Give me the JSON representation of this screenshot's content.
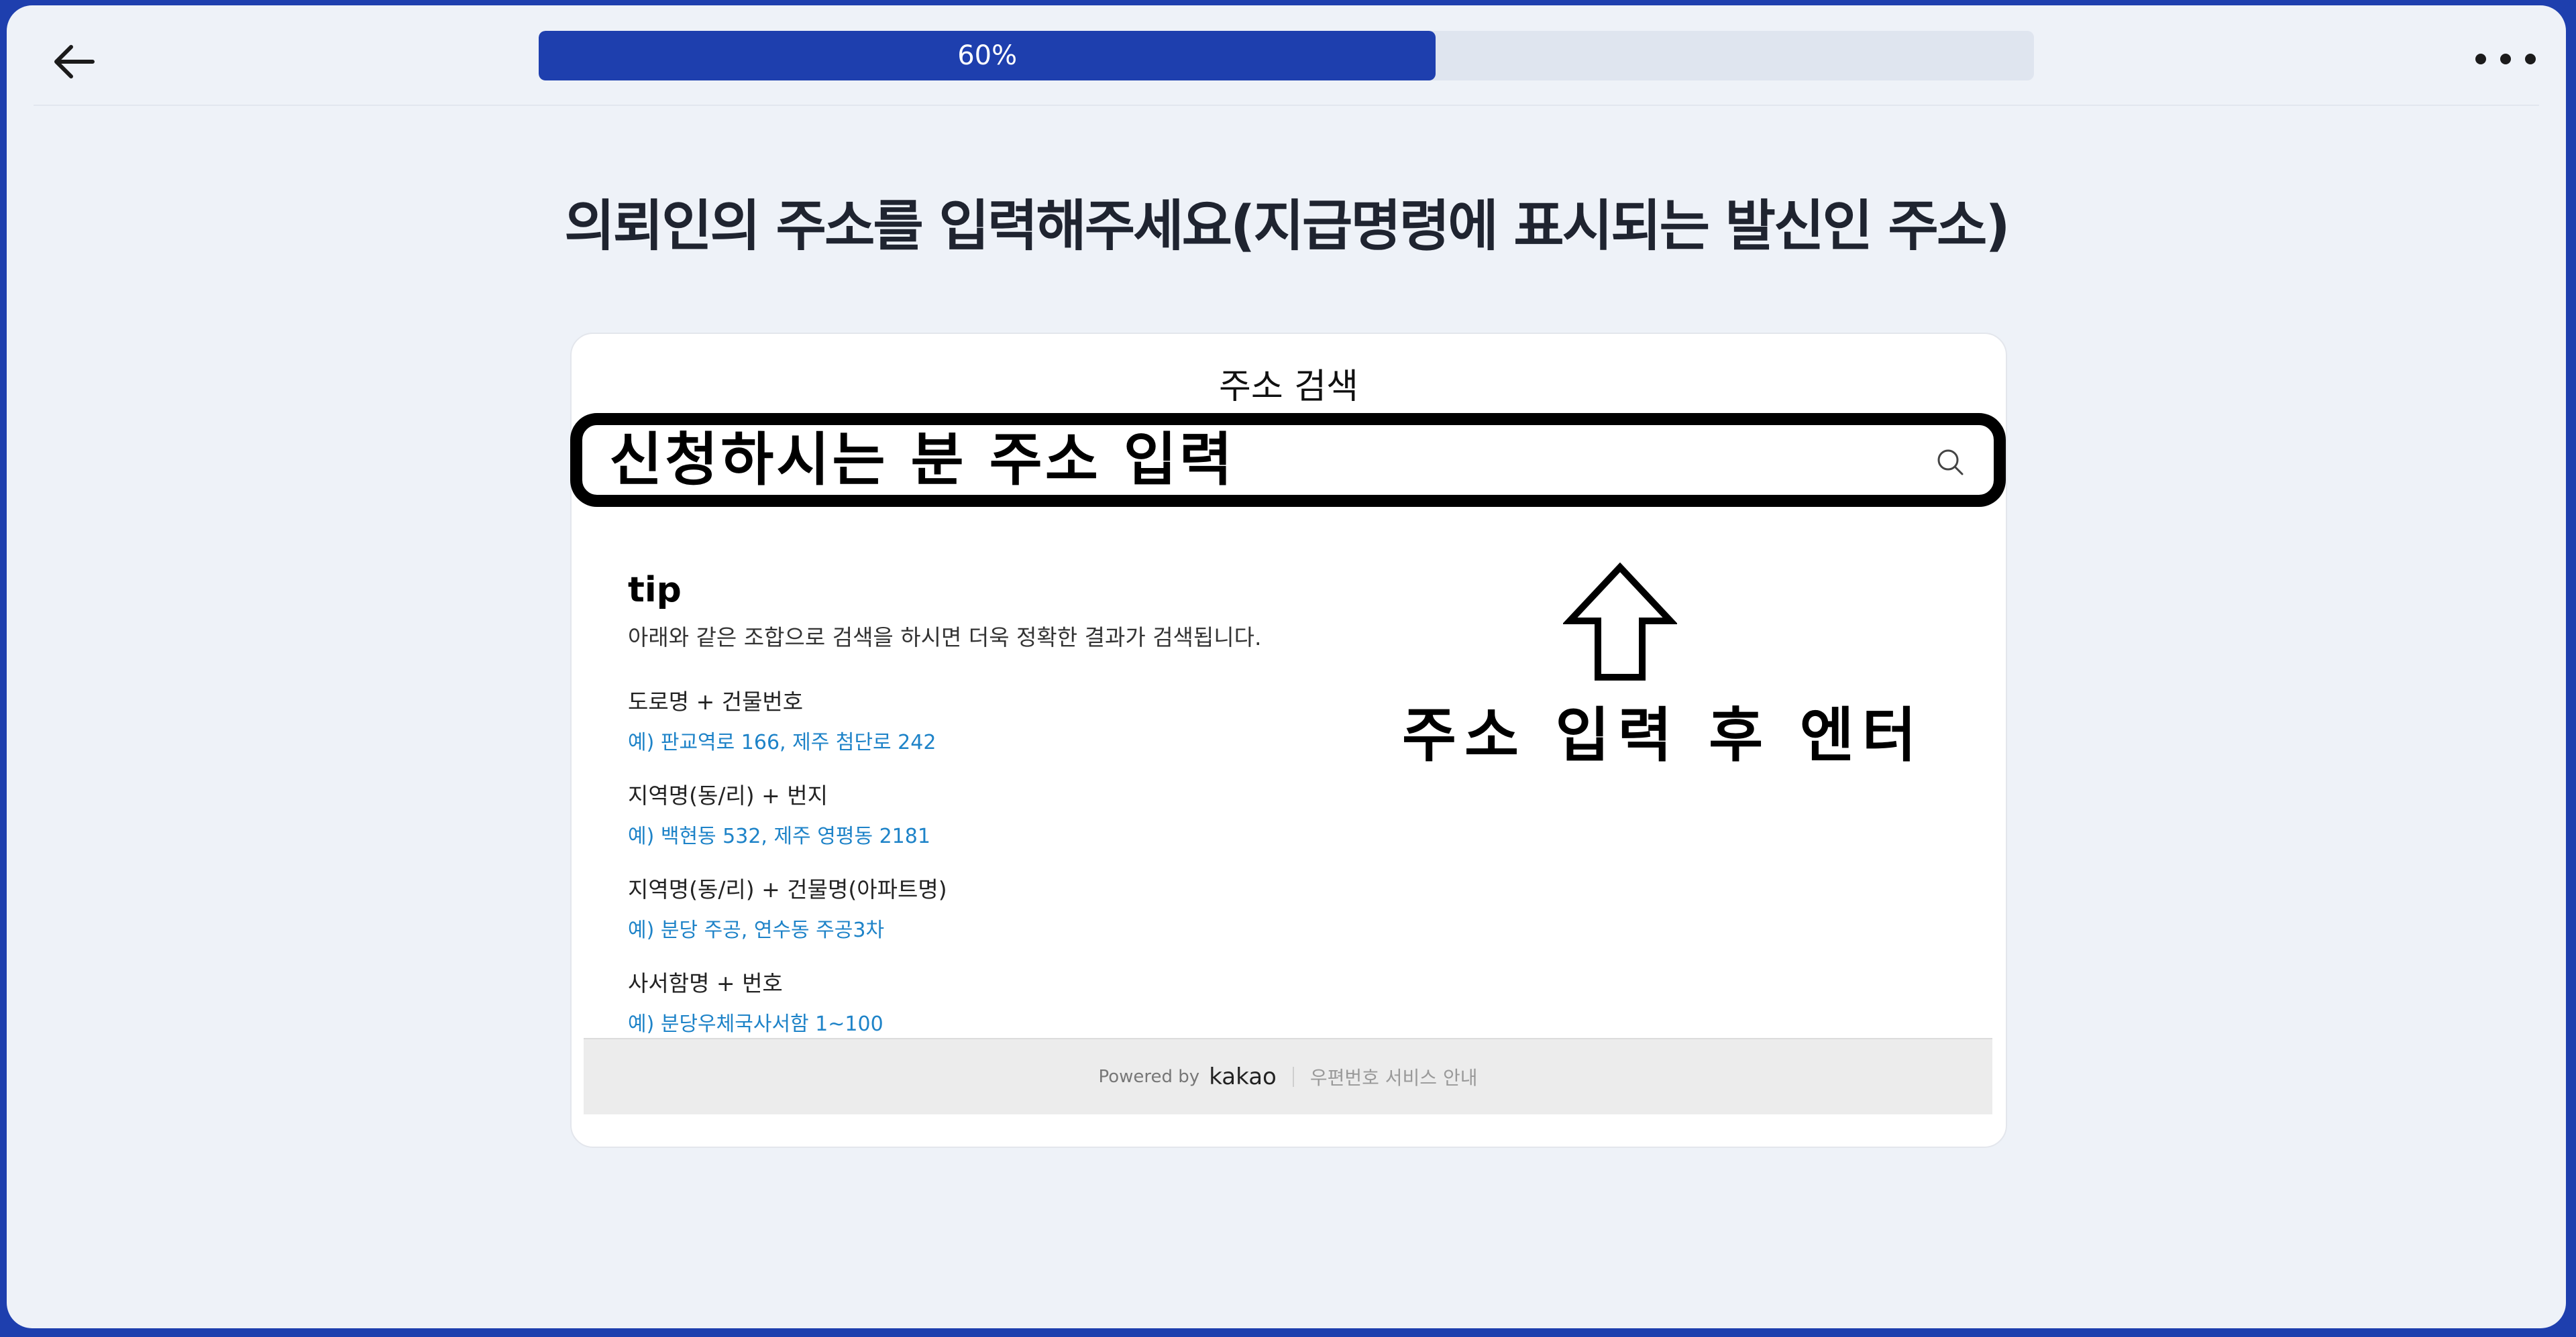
{
  "header": {
    "back_icon": "arrow-left-icon",
    "progress_label": "60%",
    "progress_value": 0.6,
    "more_icon": "more-horizontal-icon"
  },
  "page": {
    "title": "의뢰인의 주소를 입력해주세요(지급명령에 표시되는 발신인 주소)"
  },
  "address_search": {
    "title": "주소 검색",
    "placeholder": "신청하시는 분 주소 입력",
    "search_icon": "search-icon",
    "tip": {
      "heading": "tip",
      "description": "아래와 같은 조합으로 검색을 하시면 더욱 정확한 결과가 검색됩니다.",
      "items": [
        {
          "label": "도로명 + 건물번호",
          "example": "예) 판교역로 166,  제주 첨단로 242"
        },
        {
          "label": "지역명(동/리) + 번지",
          "example": "예) 백현동 532,  제주 영평동 2181"
        },
        {
          "label": "지역명(동/리) + 건물명(아파트명)",
          "example": "예) 분당 주공,  연수동 주공3차"
        },
        {
          "label": "사서함명 + 번호",
          "example": "예) 분당우체국사서함 1~100"
        }
      ]
    },
    "footer": {
      "powered_by": "Powered by",
      "brand": "kakao",
      "postal_guide": "우편번호 서비스 안내"
    }
  },
  "annotation": {
    "text": "주소 입력 후 엔터",
    "arrow_icon": "up-arrow-outline-icon"
  },
  "colors": {
    "brand": "#1e3fae",
    "background": "#eef2f8",
    "link": "#1e83c8"
  }
}
